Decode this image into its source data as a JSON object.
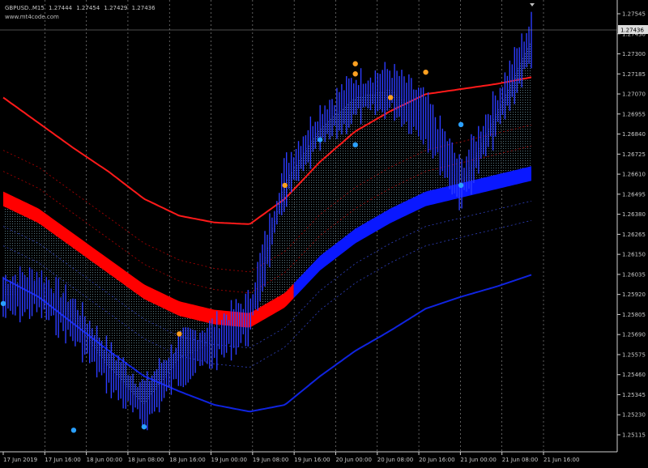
{
  "header": {
    "symbol": "GBPUSD..M15",
    "ohlc": [
      "1.27444",
      "1.27454",
      "1.27429",
      "1.27436"
    ],
    "site": "www.mt4code.com"
  },
  "price_axis": {
    "ticks": [
      "1.27545",
      "1.27430",
      "1.27300",
      "1.27185",
      "1.27070",
      "1.26955",
      "1.26840",
      "1.26725",
      "1.26610",
      "1.26495",
      "1.26380",
      "1.26265",
      "1.26150",
      "1.26035",
      "1.25920",
      "1.25805",
      "1.25690",
      "1.25575",
      "1.25460",
      "1.25345",
      "1.25230",
      "1.25115"
    ],
    "current_price": "1.27436"
  },
  "time_axis": {
    "ticks": [
      "17 Jun 2019",
      "17 Jun 16:00",
      "18 Jun 00:00",
      "18 Jun 08:00",
      "18 Jun 16:00",
      "19 Jun 00:00",
      "19 Jun 08:00",
      "19 Jun 16:00",
      "20 Jun 00:00",
      "20 Jun 08:00",
      "20 Jun 16:00",
      "21 Jun 00:00",
      "21 Jun 08:00",
      "21 Jun 16:00"
    ]
  },
  "colors": {
    "background": "#000000",
    "price_bars": "#2c3cff",
    "fill_hatch": "#9ad2e6",
    "fill_hatch_orange": "#d89a5a",
    "upper_band": "#ff1a1a",
    "lower_band": "#1024e0",
    "middle_fill_red": "#ff0000",
    "middle_fill_blue": "#0a18ff",
    "dot_orange": "#ffa020",
    "dot_blue": "#2aa0ff",
    "grid": "#9a9a9a"
  },
  "chart_data": {
    "type": "line",
    "title": "",
    "xlabel": "",
    "ylabel": "",
    "ylim": [
      1.2505,
      1.2762
    ],
    "grid": true,
    "x": [
      "17 Jun 2019",
      "17 Jun 08:00",
      "17 Jun 16:00",
      "18 Jun 00:00",
      "18 Jun 08:00",
      "18 Jun 16:00",
      "19 Jun 00:00",
      "19 Jun 08:00",
      "19 Jun 16:00",
      "20 Jun 00:00",
      "20 Jun 08:00",
      "20 Jun 16:00",
      "21 Jun 00:00",
      "21 Jun 08:00",
      "21 Jun 16:00",
      "21 Jun 18:00"
    ],
    "series": [
      {
        "values": [
          1.2592,
          1.2595,
          1.2578,
          1.255,
          1.2528,
          1.2555,
          1.2565,
          1.258,
          1.266,
          1.2692,
          1.271,
          1.2715,
          1.2698,
          1.2658,
          1.27,
          1.2744
        ]
      },
      {
        "values": [
          1.271,
          1.2695,
          1.268,
          1.2666,
          1.265,
          1.264,
          1.2636,
          1.2635,
          1.265,
          1.2672,
          1.269,
          1.2702,
          1.2712,
          1.2715,
          1.2718,
          1.2722
        ]
      },
      {
        "values": [
          1.265,
          1.264,
          1.2625,
          1.261,
          1.2595,
          1.2585,
          1.258,
          1.2578,
          1.259,
          1.2612,
          1.2628,
          1.264,
          1.265,
          1.2655,
          1.266,
          1.2665
        ]
      },
      {
        "values": [
          1.2603,
          1.2592,
          1.2576,
          1.256,
          1.2545,
          1.2536,
          1.2528,
          1.2524,
          1.2528,
          1.2545,
          1.256,
          1.2572,
          1.2585,
          1.2592,
          1.2598,
          1.2605
        ]
      }
    ],
    "markers": [
      {
        "x": "17 Jun 2019",
        "y": 1.2588,
        "color": "blue"
      },
      {
        "x": "17 Jun 16:00",
        "y": 1.2513,
        "color": "blue"
      },
      {
        "x": "18 Jun 08:00",
        "y": 1.2515,
        "color": "blue"
      },
      {
        "x": "18 Jun 16:00",
        "y": 1.257,
        "color": "orange"
      },
      {
        "x": "19 Jun 16:00",
        "y": 1.2658,
        "color": "orange"
      },
      {
        "x": "20 Jun 00:00",
        "y": 1.2685,
        "color": "blue"
      },
      {
        "x": "20 Jun 08:00",
        "y": 1.273,
        "color": "orange"
      },
      {
        "x": "20 Jun 08:00",
        "y": 1.2724,
        "color": "orange"
      },
      {
        "x": "20 Jun 08:00",
        "y": 1.2682,
        "color": "blue"
      },
      {
        "x": "20 Jun 16:00",
        "y": 1.271,
        "color": "orange"
      },
      {
        "x": "21 Jun 00:00",
        "y": 1.2725,
        "color": "orange"
      },
      {
        "x": "21 Jun 08:00",
        "y": 1.2694,
        "color": "blue"
      },
      {
        "x": "21 Jun 08:00",
        "y": 1.2658,
        "color": "blue"
      }
    ]
  }
}
